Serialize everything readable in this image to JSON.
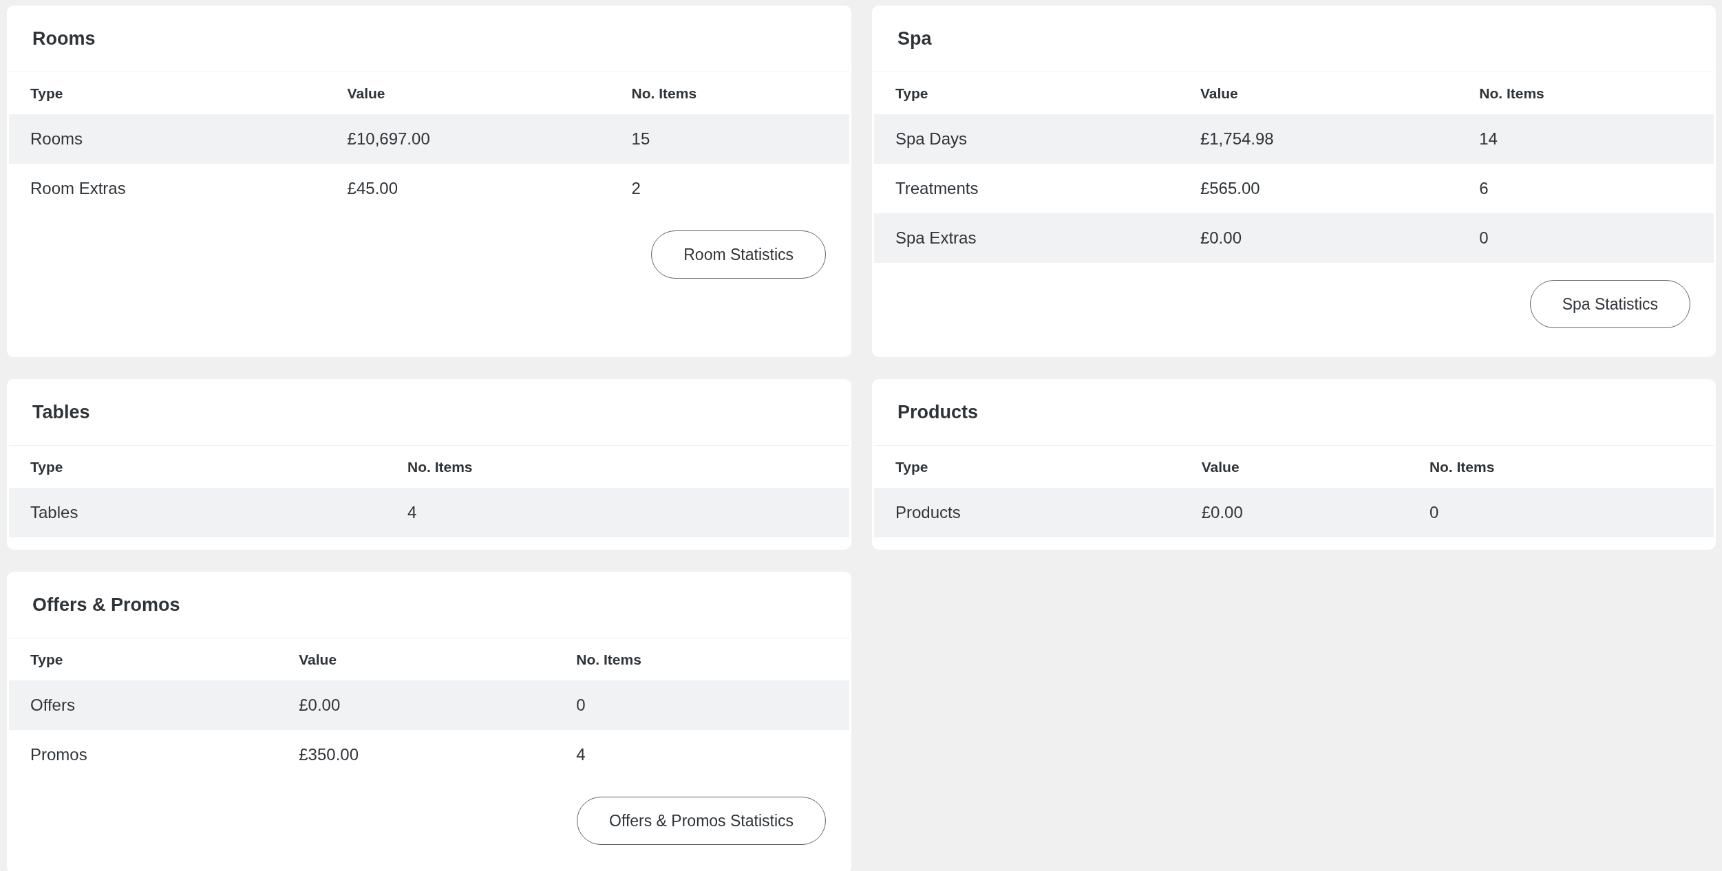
{
  "cards": [
    {
      "title": "Rooms",
      "columns": [
        "Type",
        "Value",
        "No. Items"
      ],
      "rows": [
        [
          "Rooms",
          "£10,697.00",
          "15"
        ],
        [
          "Room Extras",
          "£45.00",
          "2"
        ]
      ],
      "button": "Room Statistics"
    },
    {
      "title": "Spa",
      "columns": [
        "Type",
        "Value",
        "No. Items"
      ],
      "rows": [
        [
          "Spa Days",
          "£1,754.98",
          "14"
        ],
        [
          "Treatments",
          "£565.00",
          "6"
        ],
        [
          "Spa Extras",
          "£0.00",
          "0"
        ]
      ],
      "button": "Spa Statistics"
    },
    {
      "title": "Tables",
      "columns": [
        "Type",
        "No. Items"
      ],
      "rows": [
        [
          "Tables",
          "4"
        ]
      ]
    },
    {
      "title": "Products",
      "columns": [
        "Type",
        "Value",
        "No. Items"
      ],
      "rows": [
        [
          "Products",
          "£0.00",
          "0"
        ]
      ]
    },
    {
      "title": "Offers & Promos",
      "columns": [
        "Type",
        "Value",
        "No. Items"
      ],
      "rows": [
        [
          "Offers",
          "£0.00",
          "0"
        ],
        [
          "Promos",
          "£350.00",
          "4"
        ]
      ],
      "button": "Offers & Promos Statistics"
    }
  ]
}
